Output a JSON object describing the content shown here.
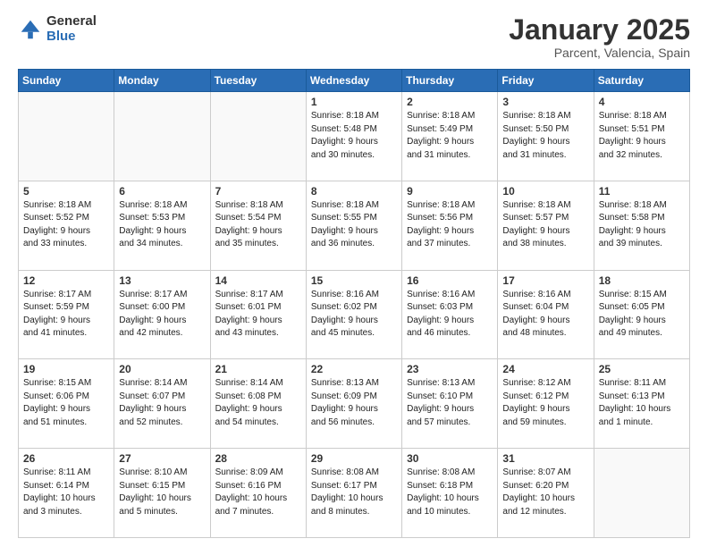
{
  "header": {
    "logo_general": "General",
    "logo_blue": "Blue",
    "month_title": "January 2025",
    "location": "Parcent, Valencia, Spain"
  },
  "days_of_week": [
    "Sunday",
    "Monday",
    "Tuesday",
    "Wednesday",
    "Thursday",
    "Friday",
    "Saturday"
  ],
  "weeks": [
    [
      {
        "day": "",
        "info": ""
      },
      {
        "day": "",
        "info": ""
      },
      {
        "day": "",
        "info": ""
      },
      {
        "day": "1",
        "info": "Sunrise: 8:18 AM\nSunset: 5:48 PM\nDaylight: 9 hours\nand 30 minutes."
      },
      {
        "day": "2",
        "info": "Sunrise: 8:18 AM\nSunset: 5:49 PM\nDaylight: 9 hours\nand 31 minutes."
      },
      {
        "day": "3",
        "info": "Sunrise: 8:18 AM\nSunset: 5:50 PM\nDaylight: 9 hours\nand 31 minutes."
      },
      {
        "day": "4",
        "info": "Sunrise: 8:18 AM\nSunset: 5:51 PM\nDaylight: 9 hours\nand 32 minutes."
      }
    ],
    [
      {
        "day": "5",
        "info": "Sunrise: 8:18 AM\nSunset: 5:52 PM\nDaylight: 9 hours\nand 33 minutes."
      },
      {
        "day": "6",
        "info": "Sunrise: 8:18 AM\nSunset: 5:53 PM\nDaylight: 9 hours\nand 34 minutes."
      },
      {
        "day": "7",
        "info": "Sunrise: 8:18 AM\nSunset: 5:54 PM\nDaylight: 9 hours\nand 35 minutes."
      },
      {
        "day": "8",
        "info": "Sunrise: 8:18 AM\nSunset: 5:55 PM\nDaylight: 9 hours\nand 36 minutes."
      },
      {
        "day": "9",
        "info": "Sunrise: 8:18 AM\nSunset: 5:56 PM\nDaylight: 9 hours\nand 37 minutes."
      },
      {
        "day": "10",
        "info": "Sunrise: 8:18 AM\nSunset: 5:57 PM\nDaylight: 9 hours\nand 38 minutes."
      },
      {
        "day": "11",
        "info": "Sunrise: 8:18 AM\nSunset: 5:58 PM\nDaylight: 9 hours\nand 39 minutes."
      }
    ],
    [
      {
        "day": "12",
        "info": "Sunrise: 8:17 AM\nSunset: 5:59 PM\nDaylight: 9 hours\nand 41 minutes."
      },
      {
        "day": "13",
        "info": "Sunrise: 8:17 AM\nSunset: 6:00 PM\nDaylight: 9 hours\nand 42 minutes."
      },
      {
        "day": "14",
        "info": "Sunrise: 8:17 AM\nSunset: 6:01 PM\nDaylight: 9 hours\nand 43 minutes."
      },
      {
        "day": "15",
        "info": "Sunrise: 8:16 AM\nSunset: 6:02 PM\nDaylight: 9 hours\nand 45 minutes."
      },
      {
        "day": "16",
        "info": "Sunrise: 8:16 AM\nSunset: 6:03 PM\nDaylight: 9 hours\nand 46 minutes."
      },
      {
        "day": "17",
        "info": "Sunrise: 8:16 AM\nSunset: 6:04 PM\nDaylight: 9 hours\nand 48 minutes."
      },
      {
        "day": "18",
        "info": "Sunrise: 8:15 AM\nSunset: 6:05 PM\nDaylight: 9 hours\nand 49 minutes."
      }
    ],
    [
      {
        "day": "19",
        "info": "Sunrise: 8:15 AM\nSunset: 6:06 PM\nDaylight: 9 hours\nand 51 minutes."
      },
      {
        "day": "20",
        "info": "Sunrise: 8:14 AM\nSunset: 6:07 PM\nDaylight: 9 hours\nand 52 minutes."
      },
      {
        "day": "21",
        "info": "Sunrise: 8:14 AM\nSunset: 6:08 PM\nDaylight: 9 hours\nand 54 minutes."
      },
      {
        "day": "22",
        "info": "Sunrise: 8:13 AM\nSunset: 6:09 PM\nDaylight: 9 hours\nand 56 minutes."
      },
      {
        "day": "23",
        "info": "Sunrise: 8:13 AM\nSunset: 6:10 PM\nDaylight: 9 hours\nand 57 minutes."
      },
      {
        "day": "24",
        "info": "Sunrise: 8:12 AM\nSunset: 6:12 PM\nDaylight: 9 hours\nand 59 minutes."
      },
      {
        "day": "25",
        "info": "Sunrise: 8:11 AM\nSunset: 6:13 PM\nDaylight: 10 hours\nand 1 minute."
      }
    ],
    [
      {
        "day": "26",
        "info": "Sunrise: 8:11 AM\nSunset: 6:14 PM\nDaylight: 10 hours\nand 3 minutes."
      },
      {
        "day": "27",
        "info": "Sunrise: 8:10 AM\nSunset: 6:15 PM\nDaylight: 10 hours\nand 5 minutes."
      },
      {
        "day": "28",
        "info": "Sunrise: 8:09 AM\nSunset: 6:16 PM\nDaylight: 10 hours\nand 7 minutes."
      },
      {
        "day": "29",
        "info": "Sunrise: 8:08 AM\nSunset: 6:17 PM\nDaylight: 10 hours\nand 8 minutes."
      },
      {
        "day": "30",
        "info": "Sunrise: 8:08 AM\nSunset: 6:18 PM\nDaylight: 10 hours\nand 10 minutes."
      },
      {
        "day": "31",
        "info": "Sunrise: 8:07 AM\nSunset: 6:20 PM\nDaylight: 10 hours\nand 12 minutes."
      },
      {
        "day": "",
        "info": ""
      }
    ]
  ]
}
